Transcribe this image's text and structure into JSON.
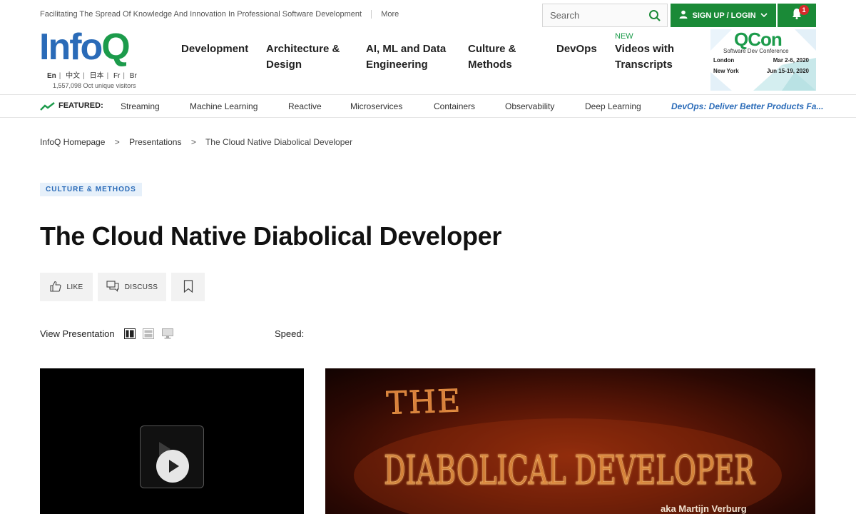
{
  "topbar": {
    "tagline": "Facilitating The Spread Of Knowledge And Innovation In Professional Software Development",
    "more": "More",
    "search_placeholder": "Search",
    "signup_label": "SIGN UP / LOGIN",
    "notification_count": "1"
  },
  "logo": {
    "info": "Info",
    "q": "Q",
    "languages": [
      "En",
      "中文",
      "日本",
      "Fr",
      "Br"
    ],
    "visitors": "1,557,098 Oct unique visitors"
  },
  "nav": {
    "items": [
      {
        "line1": "Development",
        "line2": ""
      },
      {
        "line1": "Architecture &",
        "line2": "Design"
      },
      {
        "line1": "AI, ML and Data",
        "line2": "Engineering"
      },
      {
        "line1": "Culture &",
        "line2": "Methods"
      },
      {
        "line1": "DevOps",
        "line2": ""
      },
      {
        "line1": "Videos with",
        "line2": "Transcripts"
      }
    ],
    "new_tag": "NEW"
  },
  "qcon": {
    "title": "QCon",
    "subtitle": "Software Dev Conference",
    "events": [
      {
        "city": "London",
        "dates": "Mar 2-6, 2020"
      },
      {
        "city": "New York",
        "dates": "Jun 15-19, 2020"
      }
    ]
  },
  "featured": {
    "label": "FEATURED:",
    "items": [
      "Streaming",
      "Machine Learning",
      "Reactive",
      "Microservices",
      "Containers",
      "Observability",
      "Deep Learning"
    ],
    "promo": "DevOps: Deliver Better Products Fa..."
  },
  "breadcrumb": {
    "items": [
      "InfoQ Homepage",
      "Presentations",
      "The Cloud Native Diabolical Developer"
    ],
    "separator": ">"
  },
  "article": {
    "category": "CULTURE & METHODS",
    "title": "The Cloud Native Diabolical Developer",
    "like_label": "LIKE",
    "discuss_label": "DISCUSS"
  },
  "presentation": {
    "view_label": "View Presentation",
    "speed_label": "Speed:",
    "slide_title_top": "THE",
    "slide_title_main": "DIABOLICAL DEVELOPER",
    "slide_caption": "aka Martijn Verburg"
  },
  "colors": {
    "brand_green": "#1a8a37",
    "brand_blue": "#2a6bb8",
    "alert_red": "#d62b2b"
  }
}
